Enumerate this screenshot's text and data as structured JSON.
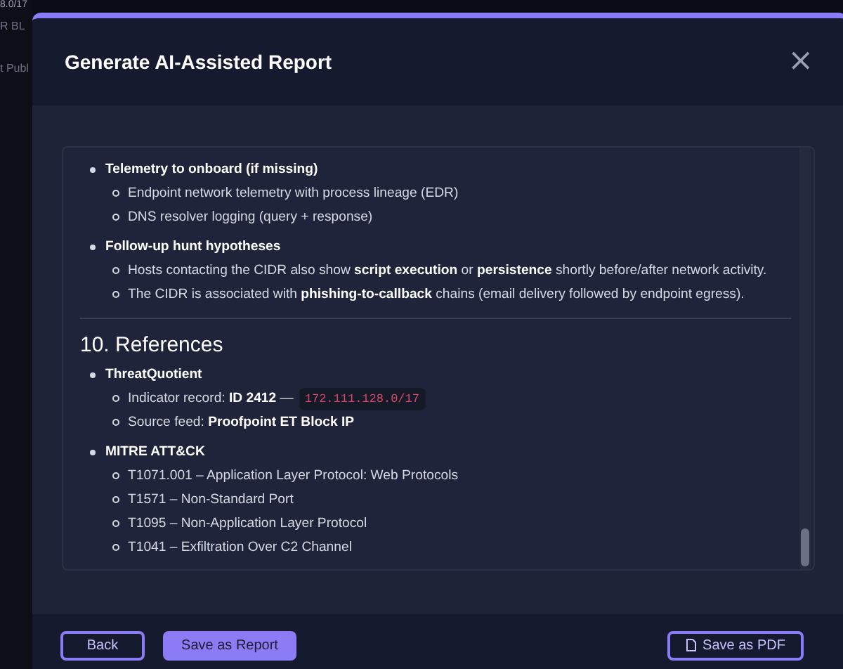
{
  "background": {
    "title": "8.0/17",
    "line_1": "R BL",
    "line_2": "t Publ"
  },
  "dialog": {
    "title": "Generate AI-Assisted Report",
    "close": "×"
  },
  "report": [
    {
      "kind": "item",
      "title": "Telemetry to onboard (if missing)",
      "children": [
        {
          "text": "Endpoint network telemetry with process lineage (EDR)"
        },
        {
          "text": "DNS resolver logging (query + response)"
        }
      ]
    },
    {
      "kind": "item",
      "title": "Follow-up hunt hypotheses",
      "children": [
        {
          "text": "Hosts contacting the CIDR also show **script execution** or **persistence** shortly before/after network activity."
        },
        {
          "text": "The CIDR is associated with **phishing-to-callback** chains (email delivery followed by endpoint egress)."
        }
      ]
    },
    {
      "kind": "rule"
    },
    {
      "kind": "heading",
      "title": "10. References"
    },
    {
      "kind": "item",
      "title": "ThreatQuotient",
      "children": [
        {
          "text": "Indicator record: **ID 2412** — ",
          "code": "172.111.128.0/17"
        },
        {
          "text": "Source feed: **Proofpoint ET Block IP**"
        }
      ]
    },
    {
      "kind": "item",
      "title": "MITRE ATT&CK",
      "children": [
        {
          "text": "T1071.001 – Application Layer Protocol: Web Protocols"
        },
        {
          "text": "T1571 – Non-Standard Port"
        },
        {
          "text": "T1095 – Non-Application Layer Protocol"
        },
        {
          "text": "T1041 – Exfiltration Over C2 Channel"
        }
      ]
    }
  ],
  "buttons": [
    {
      "label": "Back",
      "kind": "outline"
    },
    {
      "label": "Save as Report",
      "kind": "primary"
    },
    {
      "label": "Save as PDF",
      "kind": "pdf"
    }
  ]
}
